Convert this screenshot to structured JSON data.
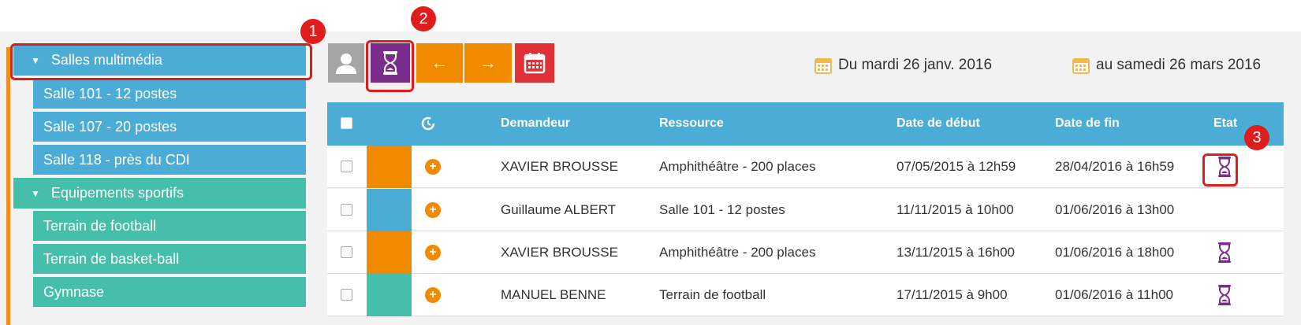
{
  "sidebar": {
    "categories": [
      {
        "label": "Salles multimédia",
        "items": [
          "Salle 101 - 12 postes",
          "Salle 107 - 20 postes",
          "Salle 118 - près du CDI"
        ]
      },
      {
        "label": "Equipements sportifs",
        "items": [
          "Terrain de football",
          "Terrain de basket-ball",
          "Gymnase"
        ]
      }
    ]
  },
  "toolbar": {
    "prev_label": "←",
    "next_label": "→",
    "date_from": "Du mardi 26 janv. 2016",
    "date_to": "au samedi 26 mars 2016"
  },
  "table": {
    "columns": [
      "Demandeur",
      "Ressource",
      "Date de début",
      "Date de fin",
      "Etat"
    ],
    "rows": [
      {
        "color": "#f28a00",
        "demandeur": "XAVIER BROUSSE",
        "ressource": "Amphithéâtre - 200 places",
        "debut": "07/05/2015 à 12h59",
        "fin": "28/04/2016 à 16h59",
        "etat": "pending"
      },
      {
        "color": "#4bacd6",
        "demandeur": "Guillaume ALBERT",
        "ressource": "Salle 101 - 12 postes",
        "debut": "11/11/2015 à 10h00",
        "fin": "01/06/2016 à 13h00",
        "etat": ""
      },
      {
        "color": "#f28a00",
        "demandeur": "XAVIER BROUSSE",
        "ressource": "Amphithéâtre - 200 places",
        "debut": "13/11/2015 à 16h00",
        "fin": "01/06/2016 à 18h00",
        "etat": "pending"
      },
      {
        "color": "#45bfa9",
        "demandeur": "MANUEL BENNE",
        "ressource": "Terrain de football",
        "debut": "17/11/2015 à 9h00",
        "fin": "01/06/2016 à 11h00",
        "etat": "pending"
      }
    ]
  },
  "annotations": [
    "1",
    "2",
    "3"
  ],
  "colors": {
    "blue": "#4bacd6",
    "teal": "#45bfa9",
    "orange": "#f28a00",
    "purple": "#7b2d8e",
    "red": "#e03137"
  }
}
